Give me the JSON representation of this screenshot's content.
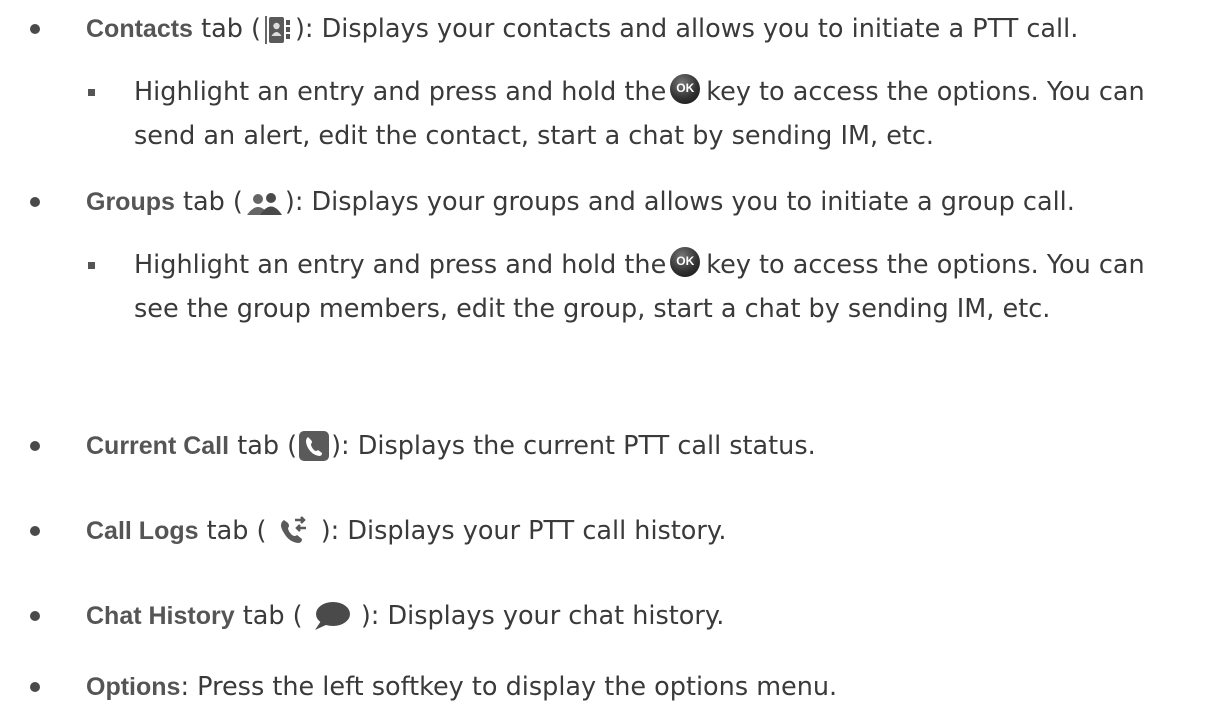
{
  "items": [
    {
      "label": "Contacts",
      "icon": "contacts-book-icon",
      "pre": " tab (",
      "post": "): Displays your contacts and allows you to initiate a PTT call.",
      "sub": {
        "line1_pre": "Highlight an entry and press and hold the",
        "key_label": "OK",
        "line1_post": "key to access the options. You can",
        "line2": "send an alert, edit the contact, start a chat by sending IM, etc."
      }
    },
    {
      "label": "Groups",
      "icon": "group-people-icon",
      "pre": " tab (",
      "post": "): Displays your groups and allows you to initiate a group call.",
      "sub": {
        "line1_pre": "Highlight an entry and press and hold the",
        "key_label": "OK",
        "line1_post": "key to access the options. You can",
        "line2": "see the group members, edit the group, start a chat by sending IM, etc."
      }
    },
    {
      "label": "Current Call",
      "icon": "phone-handset-icon",
      "pre": " tab (",
      "post": "): Displays the current PTT call status."
    },
    {
      "label": "Call Logs",
      "icon": "call-log-icon",
      "pre": " tab ( ",
      "post": " ): Displays your PTT call history."
    },
    {
      "label": "Chat History",
      "icon": "chat-bubble-icon",
      "pre": " tab ( ",
      "post": " ): Displays your chat history."
    },
    {
      "label": "Options",
      "pre": "",
      "post": ": Press the left softkey to display the options menu."
    }
  ]
}
